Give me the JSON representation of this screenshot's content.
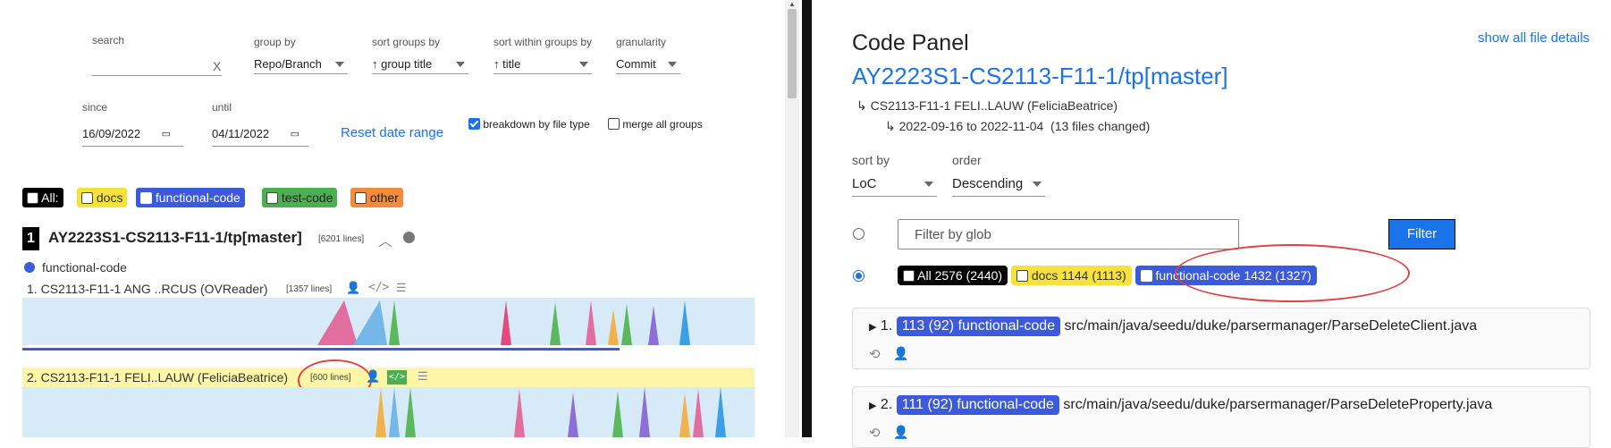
{
  "filters": {
    "search_label": "search",
    "search_clear": "X",
    "group_by_label": "group by",
    "group_by_value": "Repo/Branch",
    "sort_groups_label": "sort groups by",
    "sort_groups_value": "↑ group title",
    "sort_within_label": "sort within groups by",
    "sort_within_value": "↑ title",
    "granularity_label": "granularity",
    "granularity_value": "Commit",
    "since_label": "since",
    "since_value": "16/09/2022",
    "until_label": "until",
    "until_value": "04/11/2022",
    "reset_label": "Reset date range",
    "breakdown_label": "breakdown by file type",
    "merge_label": "merge all groups"
  },
  "filetypes": {
    "all": "All:",
    "docs": "docs",
    "functional": "functional-code",
    "test": "test-code",
    "other": "other"
  },
  "group": {
    "index": "1",
    "title": "AY2223S1-CS2113-F11-1/tp[master]",
    "lines": "[6201 lines]",
    "legend": "functional-code",
    "authors": [
      {
        "num": "1.",
        "name": "CS2113-F11-1 ANG ..RCUS (OVReader)",
        "lines": "[1357 lines]"
      },
      {
        "num": "2.",
        "name": "CS2113-F11-1 FELI..LAUW (FeliciaBeatrice)",
        "lines": "[600 lines]"
      }
    ]
  },
  "code_panel": {
    "title": "Code Panel",
    "show_all": "show all file details",
    "repo": "AY2223S1-CS2113-F11-1/tp[master]",
    "author": "↳ CS2113-F11-1 FELI..LAUW (FeliciaBeatrice)",
    "range": "↳ 2022-09-16 to 2022-11-04",
    "changed": "(13 files changed)",
    "sort_label": "sort by",
    "sort_value": "LoC",
    "order_label": "order",
    "order_value": "Descending",
    "glob_placeholder": "Filter by glob",
    "filter_button": "Filter",
    "all_chip": "All  2576  (2440)",
    "docs_chip": "docs 1144  (1113)",
    "func_chip": "functional-code 1432  (1327)",
    "files": [
      {
        "num": "1.",
        "badge": "113 (92) functional-code",
        "path": "src/main/java/seedu/duke/parsermanager/ParseDeleteClient.java"
      },
      {
        "num": "2.",
        "badge": "111 (92) functional-code",
        "path": "src/main/java/seedu/duke/parsermanager/ParseDeleteProperty.java"
      }
    ]
  },
  "colors": {
    "accent": "#1a73e8",
    "functional": "#3b5bdb",
    "docs": "#f7e23b",
    "test": "#4caf50",
    "other": "#f08c3c"
  }
}
